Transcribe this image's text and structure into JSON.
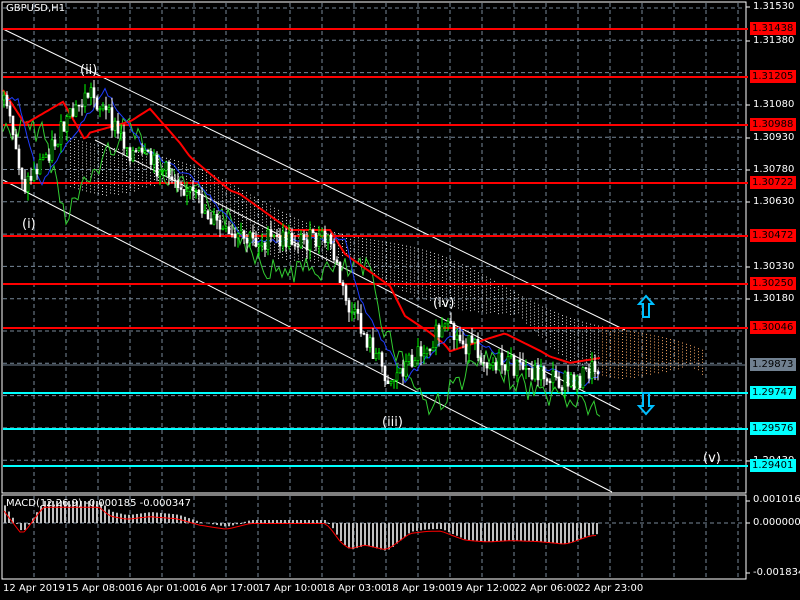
{
  "chart": {
    "symbol": "GBPUSD,H1",
    "colors": {
      "background": "#000000",
      "bull": "#00ff00",
      "bear": "#ffffff",
      "resistance": "#ff0000",
      "support": "#00ffff",
      "current": "#708090",
      "grid": "#778899"
    },
    "price_ticks": [
      "1.31530",
      "1.31380",
      "1.31080",
      "1.30930",
      "1.30780",
      "1.30630",
      "1.30330",
      "1.30180",
      "1.29430"
    ],
    "resistance_levels": [
      "1.31438",
      "1.31205",
      "1.30988",
      "1.30722",
      "1.30472",
      "1.30250",
      "1.30046"
    ],
    "current_price": "1.29873",
    "support_levels": [
      "1.29747",
      "1.29576",
      "1.29401"
    ],
    "time_labels": [
      "12 Apr 2019",
      "15 Apr 08:00",
      "16 Apr 01:00",
      "16 Apr 17:00",
      "17 Apr 10:00",
      "18 Apr 03:00",
      "18 Apr 19:00",
      "19 Apr 12:00",
      "22 Apr 06:00",
      "22 Apr 23:00"
    ],
    "wave_labels": [
      "(i)",
      "(ii)",
      "(iii)",
      "(iv)",
      "(v)"
    ],
    "arrows": {
      "up": "arrow-up-icon",
      "down": "arrow-down-icon"
    }
  },
  "macd": {
    "title": "MACD(12,26,9) -0.000185 -0.000347",
    "ticks": [
      "0.001016",
      "0.000000",
      "-0.001834"
    ]
  }
}
